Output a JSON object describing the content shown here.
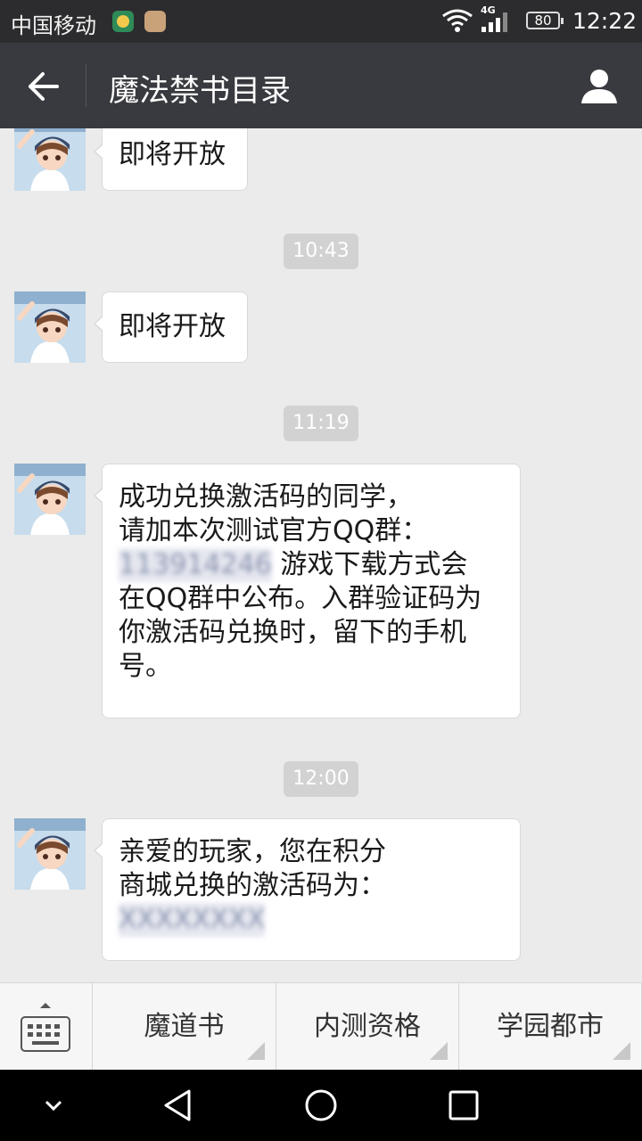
{
  "status_bar": {
    "carrier": "中国移动",
    "network": "4G",
    "battery": "80",
    "time": "12:22"
  },
  "header": {
    "title": "魔法禁书目录"
  },
  "chat": {
    "messages": [
      {
        "type": "text",
        "lines": [
          "即将开放"
        ]
      },
      {
        "type": "time",
        "text": "10:43"
      },
      {
        "type": "text",
        "lines": [
          "即将开放"
        ]
      },
      {
        "type": "time",
        "text": "11:19"
      },
      {
        "type": "text",
        "lines": [
          "成功兑换激活码的同学，",
          "请加本次测试官方QQ群：",
          "113914246",
          "游戏下载方式会",
          "在QQ群中公布。入群验证码为",
          "你激活码兑换时，留下的手机",
          "号。"
        ]
      },
      {
        "type": "time",
        "text": "12:00"
      },
      {
        "type": "text",
        "lines": [
          "亲爱的玩家，您在积分",
          "商城兑换的激活码为：",
          "XXXXXXXX"
        ]
      }
    ]
  },
  "menu": {
    "items": [
      {
        "label": "魔道书"
      },
      {
        "label": "内测资格"
      },
      {
        "label": "学园都市"
      }
    ]
  },
  "colors": {
    "header_bg": "#393a3f",
    "chat_bg": "#ebebeb",
    "timestamp_bg": "#d2d2d2",
    "bubble_bg": "#ffffff"
  }
}
